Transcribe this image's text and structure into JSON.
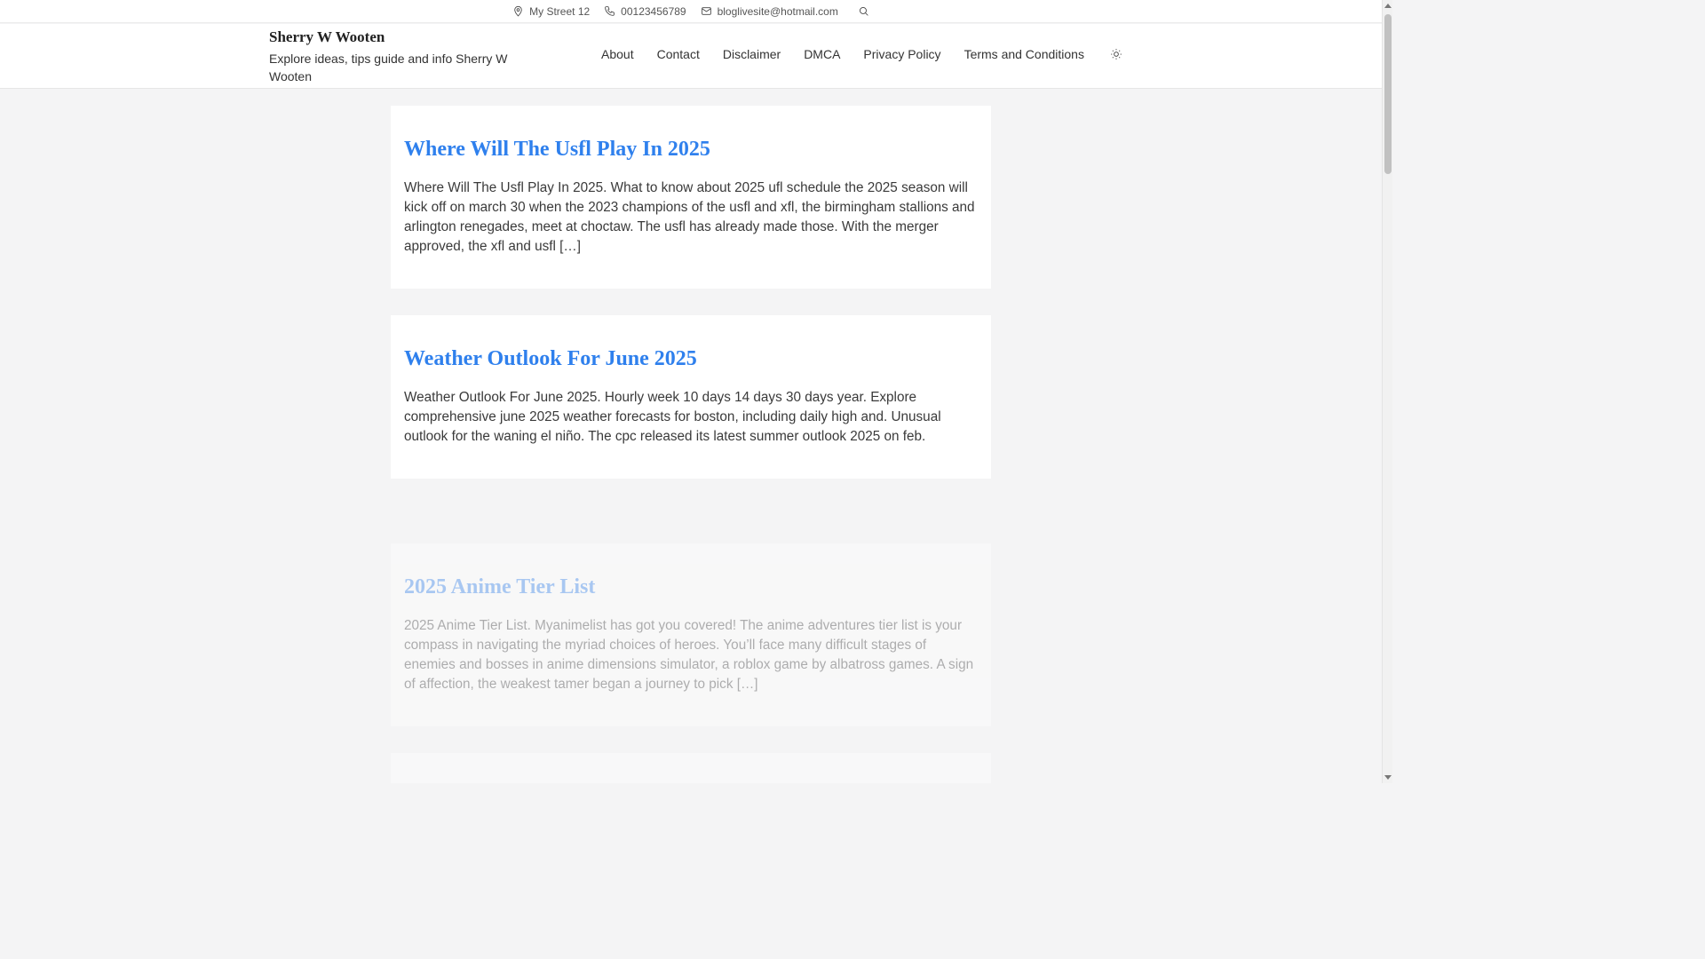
{
  "topbar": {
    "address": "My Street 12",
    "phone": "00123456789",
    "email": "bloglivesite@hotmail.com"
  },
  "header": {
    "site_title": "Sherry W Wooten",
    "tagline": "Explore ideas, tips guide and info Sherry W Wooten"
  },
  "nav": {
    "items": [
      "About",
      "Contact",
      "Disclaimer",
      "DMCA",
      "Privacy Policy",
      "Terms and Conditions"
    ]
  },
  "posts": [
    {
      "title": "Where Will The Usfl Play In 2025",
      "excerpt": "Where Will The Usfl Play In 2025. What to know about 2025 ufl schedule the 2025 season will kick off on march 30 when the 2023 champions of the usfl and xfl, the birmingham stallions and arlington renegades, meet at choctaw. The usfl has already made those. With the merger approved, the xfl and usfl […]"
    },
    {
      "title": "Weather Outlook For June 2025",
      "excerpt": "Weather Outlook For June 2025. Hourly week 10 days 14 days 30 days year. Explore comprehensive june 2025 weather forecasts for boston, including daily high and. Unusual outlook for the waning el niño. The cpc released its latest summer outlook 2025 on feb."
    },
    {
      "title": "2025 Anime Tier List",
      "excerpt": "2025 Anime Tier List. Myanimelist has got you covered! The anime adventures tier list is your compass in navigating the myriad choices of heroes. You’ll face many difficult stages of enemies and bosses in anime dimensions simulator, a roblox game by albatross games. A sign of affection, the weakest tamer began a journey to pick […]"
    }
  ],
  "colors": {
    "link": "#2f80ed",
    "background": "#f4f4f5"
  },
  "icons": [
    "location-pin-icon",
    "phone-icon",
    "mail-icon",
    "search-icon",
    "sun-icon"
  ]
}
